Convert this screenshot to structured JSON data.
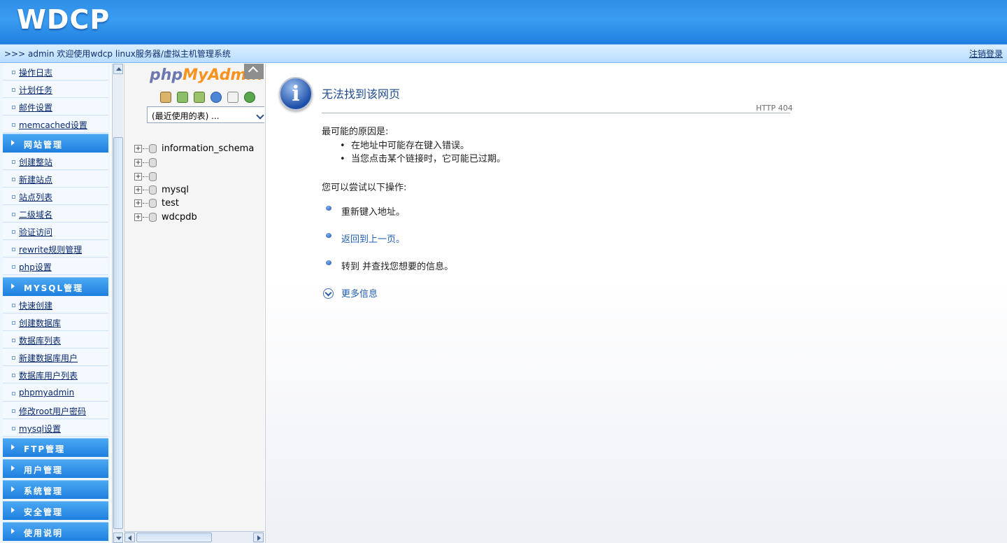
{
  "header": {
    "logo": "WDCP",
    "welcome": ">>> admin 欢迎使用wdcp linux服务器/虚拟主机管理系统",
    "logout": "注销登录"
  },
  "sidebar": {
    "top_items": [
      {
        "label": "操作日志"
      },
      {
        "label": "计划任务"
      },
      {
        "label": "邮件设置"
      },
      {
        "label": "memcached设置"
      }
    ],
    "site_group": {
      "label": "网站管理"
    },
    "site_items": [
      {
        "label": "创建整站"
      },
      {
        "label": "新建站点"
      },
      {
        "label": "站点列表"
      },
      {
        "label": "二级域名"
      },
      {
        "label": "验证访问"
      },
      {
        "label": "rewrite规则管理"
      },
      {
        "label": "php设置"
      }
    ],
    "mysql_group": {
      "label": "MYSQL管理"
    },
    "mysql_items": [
      {
        "label": "快速创建"
      },
      {
        "label": "创建数据库"
      },
      {
        "label": "数据库列表"
      },
      {
        "label": "新建数据库用户"
      },
      {
        "label": "数据库用户列表"
      },
      {
        "label": "phpmyadmin"
      },
      {
        "label": "修改root用户密码"
      },
      {
        "label": "mysql设置"
      }
    ],
    "groups_bottom": [
      {
        "label": "FTP管理"
      },
      {
        "label": "用户管理"
      },
      {
        "label": "系统管理"
      },
      {
        "label": "安全管理"
      },
      {
        "label": "使用说明"
      }
    ]
  },
  "pma": {
    "logo_php": "php",
    "logo_myadmin": "MyAdmin",
    "recent_tables": "(最近使用的表) ...",
    "icons": [
      "home-icon",
      "exit-icon",
      "query-window-icon",
      "help-icon",
      "docs-icon",
      "reload-icon"
    ],
    "databases": [
      {
        "name": "information_schema"
      },
      {
        "name": ""
      },
      {
        "name": ""
      },
      {
        "name": "mysql"
      },
      {
        "name": "test"
      },
      {
        "name": "wdcpdb"
      }
    ]
  },
  "error_page": {
    "title": "无法找到该网页",
    "code": "HTTP 404",
    "reasons_heading": "最可能的原因是:",
    "reasons": [
      "在地址中可能存在键入错误。",
      "当您点击某个链接时，它可能已过期。"
    ],
    "try_heading": "您可以尝试以下操作:",
    "actions": [
      {
        "text": "重新键入地址。",
        "link": false
      },
      {
        "text": "返回到上一页。",
        "link": true
      },
      {
        "text": "转到  并查找您想要的信息。",
        "link": false
      }
    ],
    "more_info": "更多信息"
  },
  "colors": {
    "header_blue": "#2f8ee6",
    "menu_group_blue": "#1f7fdf",
    "link_blue": "#1f5fb2"
  }
}
